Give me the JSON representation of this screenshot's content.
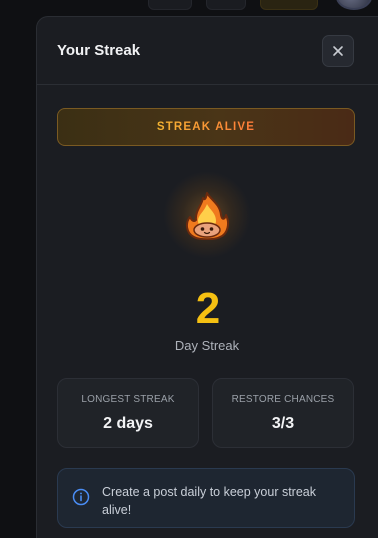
{
  "panel": {
    "title": "Your Streak",
    "close_icon": "close-icon"
  },
  "status": {
    "label": "STREAK ALIVE"
  },
  "streak": {
    "icon": "fire-icon",
    "count": "2",
    "label": "Day Streak"
  },
  "stats": [
    {
      "label": "LONGEST STREAK",
      "value": "2 days"
    },
    {
      "label": "RESTORE CHANCES",
      "value": "3/3"
    }
  ],
  "info": {
    "icon": "info-icon",
    "text": "Create a post daily to keep your streak alive!"
  },
  "colors": {
    "accent_yellow": "#f5c012",
    "accent_orange": "#ff7a3a",
    "panel_bg": "#1b1d22",
    "info_border": "#2a3a50"
  }
}
